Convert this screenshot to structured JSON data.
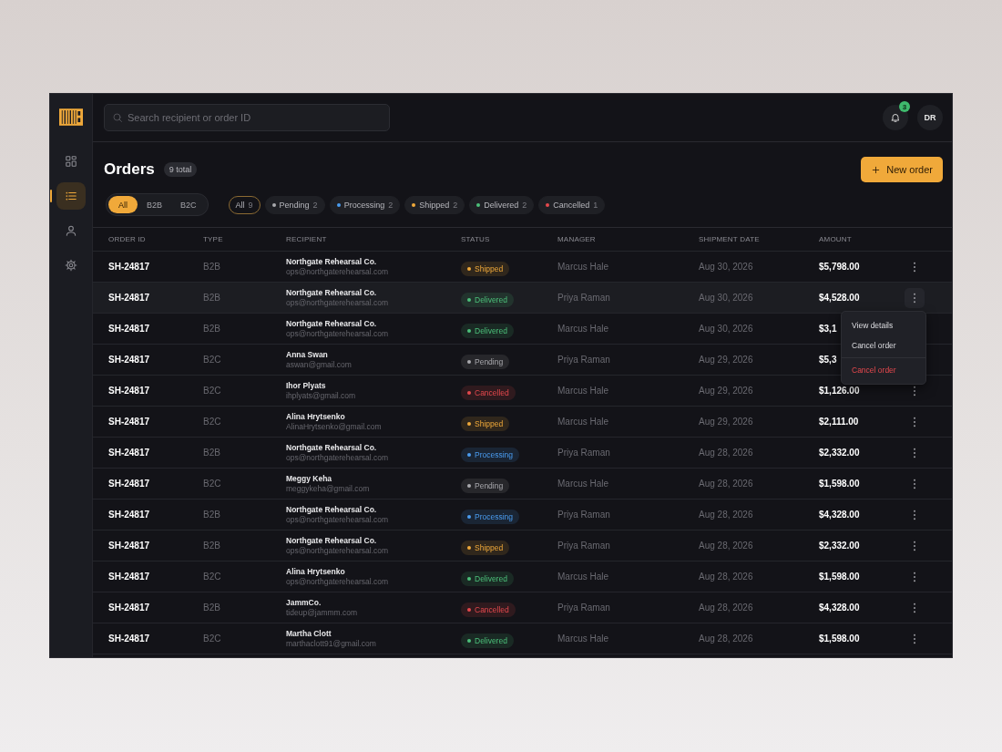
{
  "sidebar": {
    "items": [
      {
        "kind": "grid",
        "selected": false
      },
      {
        "kind": "list",
        "selected": true
      },
      {
        "kind": "user",
        "selected": false
      },
      {
        "kind": "gear",
        "selected": false
      }
    ]
  },
  "topbar": {
    "search": {
      "placeholder": "Search recipient or order ID"
    },
    "notifications": {
      "count": "3"
    },
    "avatar": {
      "initials": "DR"
    }
  },
  "header": {
    "title": "Orders",
    "total": "9 total",
    "new_button": "New order"
  },
  "type_filter": [
    {
      "label": "All",
      "selected": true
    },
    {
      "label": "B2B",
      "selected": false
    },
    {
      "label": "B2C",
      "selected": false
    }
  ],
  "status_filter": [
    {
      "label": "All",
      "count": "9",
      "selected": true
    },
    {
      "label": "Pending",
      "count": "2",
      "color": "#a9a9ae",
      "selected": false
    },
    {
      "label": "Processing",
      "count": "2",
      "color": "#4a9cf0",
      "selected": false
    },
    {
      "label": "Shipped",
      "count": "2",
      "color": "#f0a93a",
      "selected": false
    },
    {
      "label": "Delivered",
      "count": "2",
      "color": "#4cc07a",
      "selected": false
    },
    {
      "label": "Cancelled",
      "count": "1",
      "color": "#e5484d",
      "selected": false
    }
  ],
  "table": {
    "columns": [
      "ORDER ID",
      "TYPE",
      "RECIPIENT",
      "STATUS",
      "MANAGER",
      "SHIPMENT DATE",
      "AMOUNT"
    ],
    "rows": [
      {
        "order_id": "SH-24817",
        "type": "B2B",
        "name": "Northgate Rehearsal Co.",
        "email": "ops@northgaterehearsal.com",
        "status": "Shipped",
        "color": "#f0a93a",
        "manager": "Marcus Hale",
        "date": "Aug 30, 2026",
        "amount": "$5,798.00",
        "selected": false
      },
      {
        "order_id": "SH-24817",
        "type": "B2B",
        "name": "Northgate Rehearsal Co.",
        "email": "ops@northgaterehearsal.com",
        "status": "Delivered",
        "color": "#4cc07a",
        "manager": "Priya Raman",
        "date": "Aug 30, 2026",
        "amount": "$4,528.00",
        "selected": true
      },
      {
        "order_id": "SH-24817",
        "type": "B2B",
        "name": "Northgate Rehearsal Co.",
        "email": "ops@northgaterehearsal.com",
        "status": "Delivered",
        "color": "#4cc07a",
        "manager": "Marcus Hale",
        "date": "Aug 30, 2026",
        "amount": "$3,1",
        "selected": false
      },
      {
        "order_id": "SH-24817",
        "type": "B2C",
        "name": "Anna Swan",
        "email": "aswan@gmail.com",
        "status": "Pending",
        "color": "#a9a9ae",
        "manager": "Priya Raman",
        "date": "Aug 29, 2026",
        "amount": "$5,3",
        "selected": false
      },
      {
        "order_id": "SH-24817",
        "type": "B2C",
        "name": "Ihor Plyats",
        "email": "ihplyats@gmail.com",
        "status": "Cancelled",
        "color": "#e5484d",
        "manager": "Marcus Hale",
        "date": "Aug 29, 2026",
        "amount": "$1,126.00",
        "selected": false
      },
      {
        "order_id": "SH-24817",
        "type": "B2C",
        "name": "Alina Hrytsenko",
        "email": "AlinaHrytsenko@gmail.com",
        "status": "Shipped",
        "color": "#f0a93a",
        "manager": "Marcus Hale",
        "date": "Aug 29, 2026",
        "amount": "$2,111.00",
        "selected": false
      },
      {
        "order_id": "SH-24817",
        "type": "B2B",
        "name": "Northgate Rehearsal Co.",
        "email": "ops@northgaterehearsal.com",
        "status": "Processing",
        "color": "#4a9cf0",
        "manager": "Priya Raman",
        "date": "Aug 28, 2026",
        "amount": "$2,332.00",
        "selected": false
      },
      {
        "order_id": "SH-24817",
        "type": "B2C",
        "name": "Meggy Keha",
        "email": "meggykeha@gmail.com",
        "status": "Pending",
        "color": "#a9a9ae",
        "manager": "Marcus Hale",
        "date": "Aug 28, 2026",
        "amount": "$1,598.00",
        "selected": false
      },
      {
        "order_id": "SH-24817",
        "type": "B2B",
        "name": "Northgate Rehearsal Co.",
        "email": "ops@northgaterehearsal.com",
        "status": "Processing",
        "color": "#4a9cf0",
        "manager": "Priya Raman",
        "date": "Aug 28, 2026",
        "amount": "$4,328.00",
        "selected": false
      },
      {
        "order_id": "SH-24817",
        "type": "B2B",
        "name": "Northgate Rehearsal Co.",
        "email": "ops@northgaterehearsal.com",
        "status": "Shipped",
        "color": "#f0a93a",
        "manager": "Priya Raman",
        "date": "Aug 28, 2026",
        "amount": "$2,332.00",
        "selected": false
      },
      {
        "order_id": "SH-24817",
        "type": "B2C",
        "name": "Alina Hrytsenko",
        "email": "ops@northgaterehearsal.com",
        "status": "Delivered",
        "color": "#4cc07a",
        "manager": "Marcus Hale",
        "date": "Aug 28, 2026",
        "amount": "$1,598.00",
        "selected": false
      },
      {
        "order_id": "SH-24817",
        "type": "B2B",
        "name": "JammCo.",
        "email": "tideup@jammm.com",
        "status": "Cancelled",
        "color": "#e5484d",
        "manager": "Priya Raman",
        "date": "Aug 28, 2026",
        "amount": "$4,328.00",
        "selected": false
      },
      {
        "order_id": "SH-24817",
        "type": "B2C",
        "name": "Martha Clott",
        "email": "marthaclott91@gmail.com",
        "status": "Delivered",
        "color": "#4cc07a",
        "manager": "Marcus Hale",
        "date": "Aug 28, 2026",
        "amount": "$1,598.00",
        "selected": false
      }
    ]
  },
  "row_menu": {
    "items": [
      {
        "label": "View details",
        "kind": "normal"
      },
      {
        "label": "Cancel order",
        "kind": "normal"
      },
      {
        "label": "Cancel order",
        "kind": "danger"
      }
    ]
  }
}
